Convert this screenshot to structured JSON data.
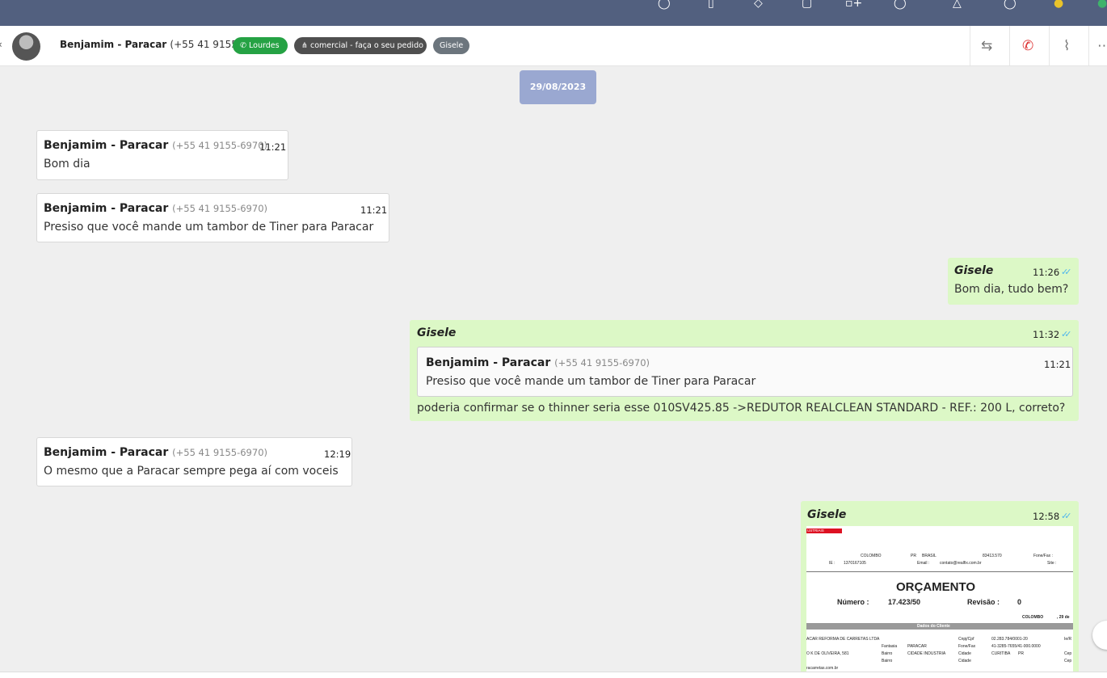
{
  "topbar": {
    "icons": [
      "chat-icon",
      "clipboard-icon",
      "tag-icon",
      "phone-icon",
      "apps-icon",
      "help-icon",
      "bell-icon",
      "menu-icon",
      "status-icon"
    ]
  },
  "header": {
    "contact_name": "Benjamim - Paracar",
    "contact_phone": "(+55 41 9155-6970)",
    "tag_whatsapp": "Lourdes",
    "tag_queue": "comercial - faça o seu pedido",
    "tag_user": "Gisele",
    "icons": [
      "transfer-icon",
      "hangup-icon",
      "attach-icon",
      "more-icon"
    ]
  },
  "date_badge": "29/08/2023",
  "messages": [
    {
      "sender": "Benjamim - Paracar",
      "phone": "(+55 41 9155-6970)",
      "time": "11:21",
      "text": "Bom dia"
    },
    {
      "sender": "Benjamim - Paracar",
      "phone": "(+55 41 9155-6970)",
      "time": "11:21",
      "text": "Presiso que você mande um tambor de Tiner para Paracar"
    },
    {
      "sender": "Gisele",
      "time": "11:26",
      "text": "Bom dia, tudo bem?"
    },
    {
      "sender": "Gisele",
      "time": "11:32",
      "quote": {
        "sender": "Benjamim - Paracar",
        "phone": "(+55 41 9155-6970)",
        "time": "11:21",
        "text": "Presiso que você mande um tambor de Tiner para Paracar"
      },
      "text": "poderia confirmar se o thinner seria esse 010SV425.85 ->REDUTOR REALCLEAN STANDARD - REF.: 200 L, correto?"
    },
    {
      "sender": "Benjamim - Paracar",
      "phone": "(+55 41 9155-6970)",
      "time": "12:19",
      "text": "O mesmo que a Paracar sempre pega aí com voceis"
    },
    {
      "sender": "Gisele",
      "time": "12:58",
      "attachment": "document"
    }
  ],
  "document": {
    "brand": "USTRIAIS",
    "city": "COLOMBO",
    "state": "PR",
    "country": "BRASIL",
    "cep": "83413.570",
    "fone_label": "Fone/Fax :",
    "ie_label": "IE :",
    "ie": "1370167105",
    "email_label": "Email :",
    "email": "contato@realfix.com.br",
    "site_label": "Site :",
    "title": "ORÇAMENTO",
    "numero_label": "Número :",
    "numero": "17.423/50",
    "revisao_label": "Revisão :",
    "revisao": "0",
    "place_date": "COLOMBO",
    "date_part": ", 29 de",
    "section": "Dados do Cliente",
    "client": "ACAR REFORMA DE CARRETAS LTDA",
    "cnpj_label": "Cnpj/Cpf",
    "cnpj": "02.283.784/0001-20",
    "ie2_label": "Ie/R",
    "fantasia_label": "Fantasia",
    "fantasia": "PARACAR",
    "fone2_label": "Fone/Fax",
    "fone2": "41-3285-7655/41-000.0000",
    "address": "O K DE OLIVEIRA, 581",
    "bairro_label": "Bairro",
    "bairro": "CIDADE INDUSTRIA",
    "cidade_label": "Cidade",
    "cidade": "CURITIBA",
    "uf": "PR",
    "cep2_label": "Cep",
    "bairro2_label": "Bairro",
    "cidade2_label": "Cidade",
    "cep3_label": "Cep",
    "web": "racarretas.com.br"
  }
}
